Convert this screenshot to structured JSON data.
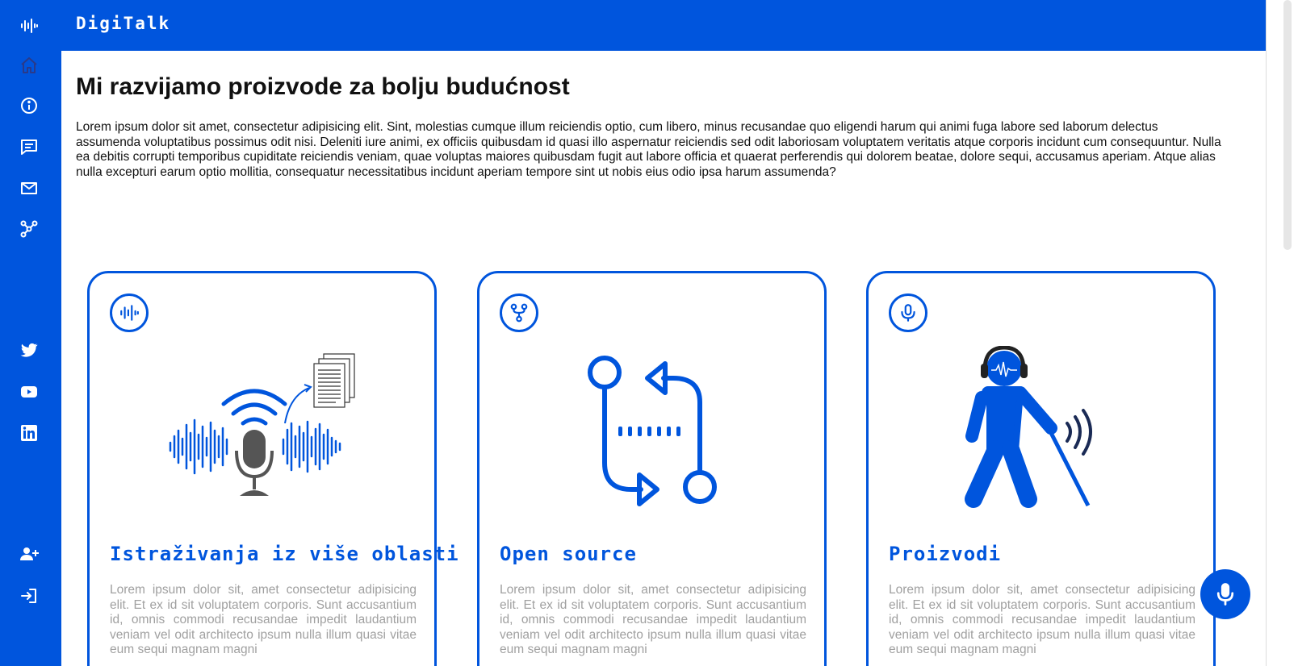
{
  "app": {
    "brand": "DigiTalk"
  },
  "colors": {
    "primary": "#0055dd",
    "text": "#111111",
    "muted": "#a0a0a0",
    "white": "#ffffff"
  },
  "sidebar": {
    "top_items": [
      {
        "icon": "soundwave-icon"
      },
      {
        "icon": "home-icon"
      },
      {
        "icon": "info-icon"
      },
      {
        "icon": "chat-icon"
      },
      {
        "icon": "mail-icon"
      },
      {
        "icon": "network-icon"
      }
    ],
    "social_items": [
      {
        "icon": "twitter-icon"
      },
      {
        "icon": "youtube-icon"
      },
      {
        "icon": "linkedin-icon"
      }
    ],
    "bottom_items": [
      {
        "icon": "add-user-icon"
      },
      {
        "icon": "login-icon"
      }
    ]
  },
  "main": {
    "title": "Mi razvijamo proizvode za bolju budućnost",
    "intro": "Lorem ipsum dolor sit amet, consectetur adipisicing elit. Sint, molestias cumque illum reiciendis optio, cum libero, minus recusandae quo eligendi harum qui animi fuga labore sed laborum delectus assumenda voluptatibus possimus odit nisi. Deleniti iure animi, ex officiis quibusdam id quasi illo aspernatur reiciendis sed odit laboriosam voluptatem veritatis atque corporis incidunt cum consequuntur. Nulla ea debitis corrupti temporibus cupiditate reiciendis veniam, quae voluptas maiores quibusdam fugit aut labore officia et quaerat perferendis qui dolorem beatae, dolore sequi, accusamus aperiam. Atque alias nulla excepturi earum optio mollitia, consequatur necessitatibus incidunt aperiam tempore sint ut nobis eius odio ipsa harum assumenda?",
    "cards": [
      {
        "badge_icon": "soundwave-icon",
        "illustration": "microphone-transcription-illustration",
        "title": "Istraživanja iz više oblasti",
        "text": "Lorem ipsum dolor sit, amet consectetur adipisicing elit. Et ex id sit voluptatem corporis. Sunt accusantium id, omnis commodi recusandae impedit laudantium veniam vel odit architecto ipsum nulla illum quasi vitae eum sequi magnam magni"
      },
      {
        "badge_icon": "git-fork-icon",
        "illustration": "open-source-flow-illustration",
        "title": "Open source",
        "text": "Lorem ipsum dolor sit, amet consectetur adipisicing elit. Et ex id sit voluptatem corporis. Sunt accusantium id, omnis commodi recusandae impedit laudantium veniam vel odit architecto ipsum nulla illum quasi vitae eum sequi magnam magni"
      },
      {
        "badge_icon": "microphone-icon",
        "illustration": "blind-person-headphones-illustration",
        "title": "Proizvodi",
        "text": "Lorem ipsum dolor sit, amet consectetur adipisicing elit. Et ex id sit voluptatem corporis. Sunt accusantium id, omnis commodi recusandae impedit laudantium veniam vel odit architecto ipsum nulla illum quasi vitae eum sequi magnam magni"
      }
    ]
  },
  "fab": {
    "icon": "microphone-icon"
  }
}
